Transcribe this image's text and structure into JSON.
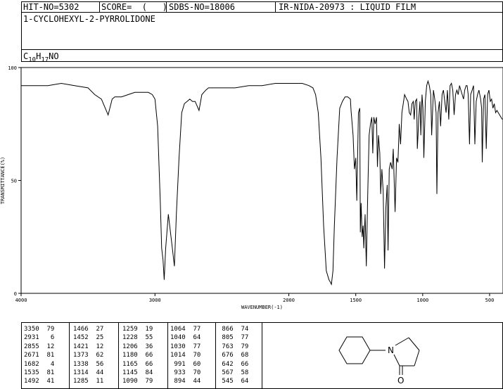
{
  "header": {
    "hit_no": "HIT-NO=5302",
    "score": "SCORE=  (   )",
    "sdbs_no": "SDBS-NO=18006",
    "ir_nida": "IR-NIDA-20973 : LIQUID FILM",
    "compound_name": "1-CYCLOHEXYL-2-PYRROLIDONE",
    "formula_parts": {
      "c": "C",
      "c_sub": "10",
      "h": "H",
      "h_sub": "17",
      "rest": "NO"
    }
  },
  "chart_data": {
    "type": "line",
    "xlabel": "WAVENUMBER(-1)",
    "ylabel": "TRANSMITTANCE(%)",
    "xlim": [
      4000,
      400
    ],
    "ylim": [
      0,
      100
    ],
    "x_reversed": true,
    "xticks": [
      "4000",
      "3000",
      "2000",
      "1500",
      "1000",
      "500"
    ],
    "yticks": [
      "0",
      "50",
      "100"
    ],
    "x": [
      4000,
      3900,
      3800,
      3700,
      3600,
      3500,
      3450,
      3400,
      3350,
      3320,
      3300,
      3250,
      3200,
      3150,
      3100,
      3050,
      3020,
      3000,
      2980,
      2960,
      2950,
      2940,
      2931,
      2920,
      2900,
      2880,
      2870,
      2855,
      2840,
      2820,
      2800,
      2780,
      2760,
      2740,
      2720,
      2700,
      2671,
      2650,
      2620,
      2600,
      2500,
      2400,
      2300,
      2200,
      2100,
      2000,
      1950,
      1900,
      1850,
      1820,
      1800,
      1780,
      1760,
      1740,
      1720,
      1700,
      1690,
      1682,
      1670,
      1660,
      1640,
      1620,
      1600,
      1580,
      1560,
      1540,
      1535,
      1520,
      1510,
      1500,
      1492,
      1480,
      1470,
      1466,
      1460,
      1452,
      1445,
      1440,
      1430,
      1421,
      1410,
      1400,
      1390,
      1380,
      1373,
      1365,
      1355,
      1345,
      1338,
      1330,
      1320,
      1314,
      1305,
      1295,
      1285,
      1275,
      1265,
      1259,
      1250,
      1240,
      1228,
      1220,
      1206,
      1195,
      1185,
      1180,
      1175,
      1165,
      1155,
      1145,
      1135,
      1120,
      1110,
      1100,
      1090,
      1080,
      1070,
      1064,
      1055,
      1045,
      1040,
      1035,
      1030,
      1020,
      1014,
      1005,
      998,
      991,
      980,
      970,
      960,
      950,
      940,
      933,
      920,
      910,
      900,
      894,
      885,
      875,
      866,
      855,
      845,
      835,
      825,
      815,
      805,
      795,
      785,
      775,
      765,
      755,
      745,
      735,
      725,
      715,
      705,
      695,
      686,
      676,
      668,
      660,
      650,
      642,
      630,
      620,
      610,
      600,
      590,
      580,
      567,
      560,
      555,
      545,
      535,
      525,
      515,
      505,
      495,
      485,
      475,
      465,
      455,
      445,
      435,
      425,
      415,
      405
    ],
    "y": [
      92,
      92,
      92,
      93,
      92,
      91,
      88,
      86,
      79,
      86,
      87,
      87,
      88,
      89,
      89,
      89,
      88,
      86,
      74,
      40,
      20,
      15,
      6,
      20,
      35,
      25,
      20,
      12,
      35,
      60,
      80,
      84,
      85,
      86,
      85,
      85,
      81,
      88,
      90,
      91,
      91,
      91,
      92,
      92,
      93,
      93,
      93,
      93,
      92,
      91,
      88,
      80,
      60,
      30,
      10,
      6,
      5,
      4,
      10,
      30,
      60,
      82,
      85,
      87,
      87,
      86,
      81,
      70,
      55,
      60,
      41,
      80,
      82,
      27,
      40,
      25,
      30,
      20,
      35,
      12,
      45,
      70,
      75,
      78,
      62,
      78,
      75,
      78,
      56,
      70,
      62,
      44,
      55,
      45,
      11,
      38,
      48,
      19,
      55,
      58,
      55,
      64,
      36,
      60,
      58,
      66,
      75,
      66,
      80,
      84,
      88,
      86,
      85,
      80,
      79,
      84,
      85,
      77,
      85,
      86,
      64,
      70,
      77,
      85,
      70,
      88,
      82,
      60,
      85,
      92,
      94,
      92,
      88,
      70,
      90,
      86,
      80,
      44,
      80,
      85,
      74,
      88,
      90,
      85,
      80,
      90,
      77,
      92,
      93,
      90,
      79,
      88,
      90,
      88,
      92,
      90,
      88,
      86,
      90,
      92,
      92,
      88,
      66,
      88,
      90,
      92,
      66,
      85,
      88,
      90,
      86,
      82,
      58,
      86,
      88,
      64,
      88,
      90,
      85,
      86,
      82,
      84,
      80,
      81,
      80,
      79,
      78,
      77,
      79,
      78
    ]
  },
  "peak_table": {
    "columns": [
      [
        [
          "3350",
          "79"
        ],
        [
          "2931",
          "6"
        ],
        [
          "2855",
          "12"
        ],
        [
          "2671",
          "81"
        ],
        [
          "1682",
          "4"
        ],
        [
          "1535",
          "81"
        ],
        [
          "1492",
          "41"
        ]
      ],
      [
        [
          "1466",
          "27"
        ],
        [
          "1452",
          "25"
        ],
        [
          "1421",
          "12"
        ],
        [
          "1373",
          "62"
        ],
        [
          "1338",
          "56"
        ],
        [
          "1314",
          "44"
        ],
        [
          "1285",
          "11"
        ]
      ],
      [
        [
          "1259",
          "19"
        ],
        [
          "1228",
          "55"
        ],
        [
          "1206",
          "36"
        ],
        [
          "1180",
          "66"
        ],
        [
          "1165",
          "66"
        ],
        [
          "1145",
          "84"
        ],
        [
          "1090",
          "79"
        ]
      ],
      [
        [
          "1064",
          "77"
        ],
        [
          "1040",
          "64"
        ],
        [
          "1030",
          "77"
        ],
        [
          "1014",
          "70"
        ],
        [
          "991",
          "60"
        ],
        [
          "933",
          "70"
        ],
        [
          "894",
          "44"
        ]
      ],
      [
        [
          "866",
          "74"
        ],
        [
          "805",
          "77"
        ],
        [
          "763",
          "79"
        ],
        [
          "676",
          "68"
        ],
        [
          "642",
          "66"
        ],
        [
          "567",
          "58"
        ],
        [
          "545",
          "64"
        ]
      ]
    ]
  },
  "structure": {
    "atom_n": "N",
    "atom_o": "O"
  }
}
